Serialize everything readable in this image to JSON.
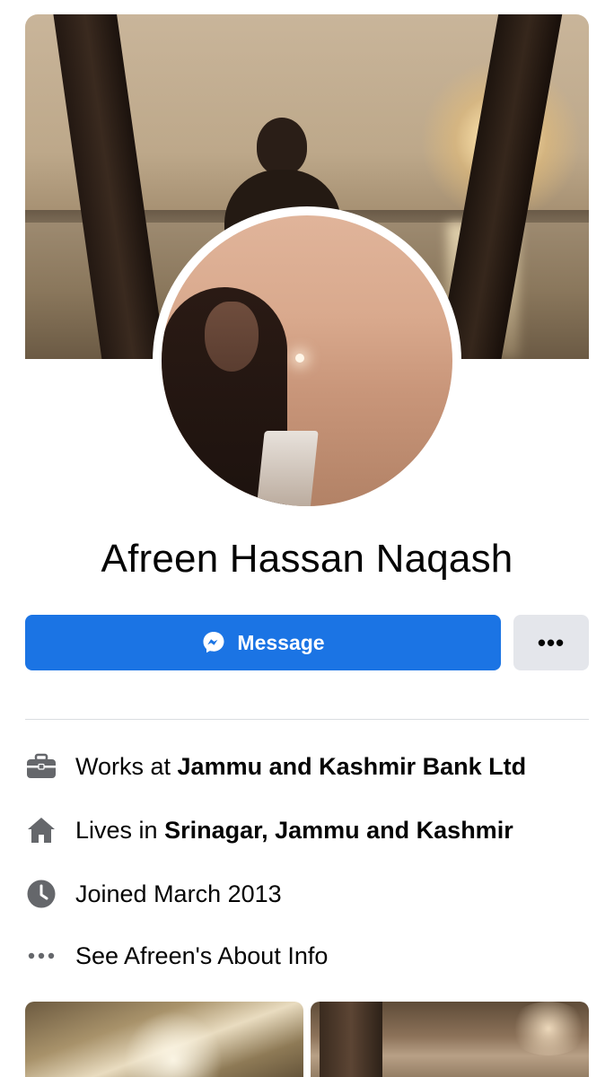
{
  "profile": {
    "name": "Afreen Hassan Naqash"
  },
  "actions": {
    "message_label": "Message",
    "more_label": "•••"
  },
  "info": {
    "work_prefix": "Works at ",
    "work_value": "Jammu and Kashmir Bank Ltd",
    "lives_prefix": "Lives in ",
    "lives_value": "Srinagar, Jammu and Kashmir",
    "joined": "Joined March 2013",
    "about_link": "See Afreen's About Info"
  },
  "icons": {
    "work": "briefcase-icon",
    "lives": "home-icon",
    "joined": "clock-icon",
    "about": "more-dots-icon",
    "message": "messenger-icon"
  },
  "colors": {
    "primary": "#1b74e4",
    "secondary_button": "#e4e6eb",
    "icon_gray": "#65676b",
    "divider": "#dadde1"
  }
}
